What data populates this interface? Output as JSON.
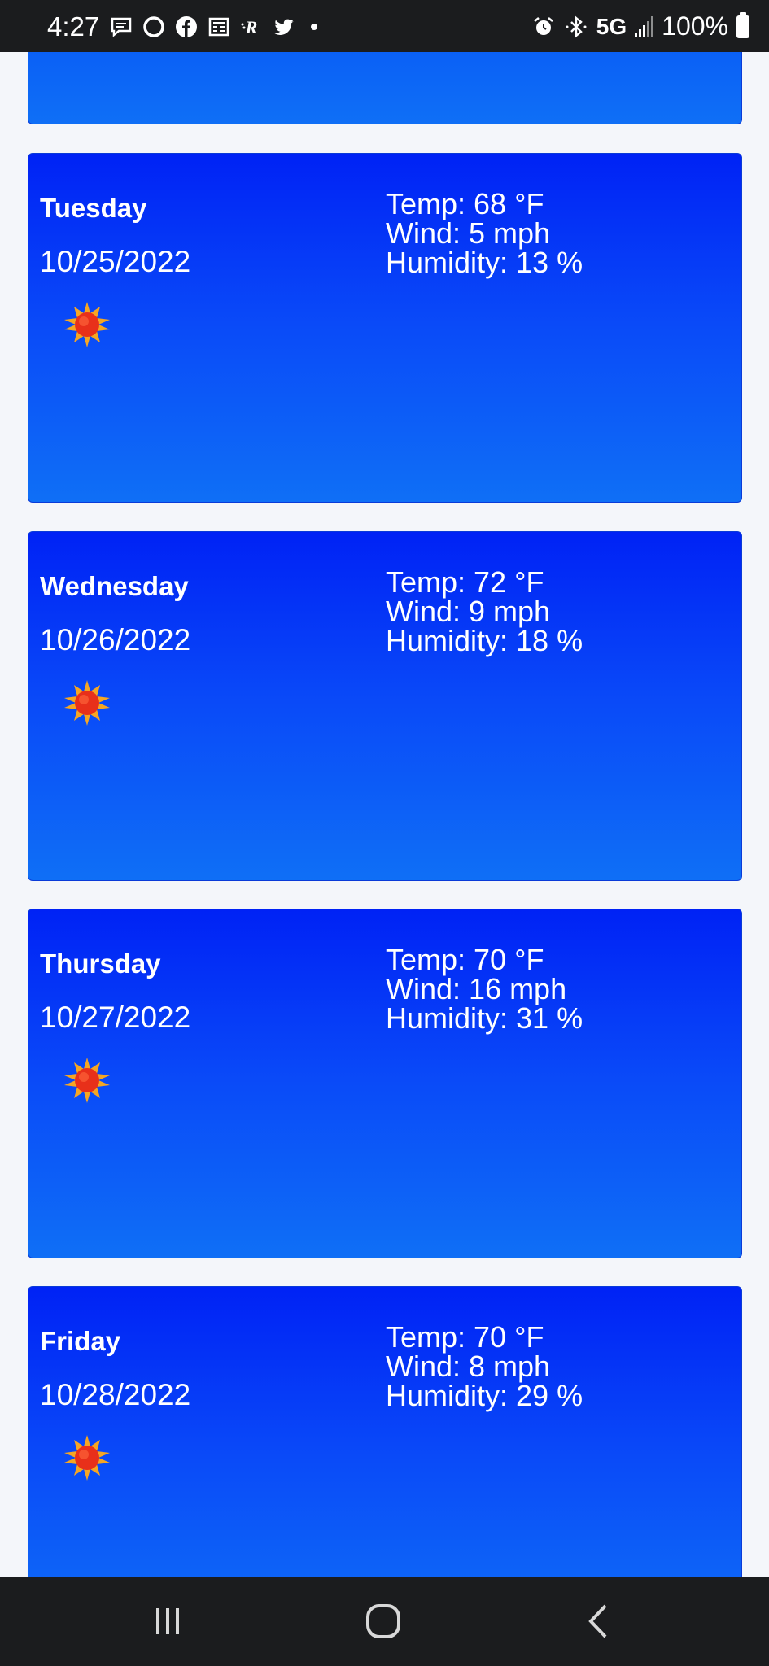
{
  "status_bar": {
    "time": "4:27",
    "network": "5G",
    "battery": "100%"
  },
  "forecast": [
    {
      "day": "Tuesday",
      "date": "10/25/2022",
      "icon": "sun-icon",
      "temp": "Temp: 68 °F",
      "wind": "Wind: 5 mph",
      "humidity": "Humidity: 13 %"
    },
    {
      "day": "Wednesday",
      "date": "10/26/2022",
      "icon": "sun-icon",
      "temp": "Temp: 72 °F",
      "wind": "Wind: 9 mph",
      "humidity": "Humidity: 18 %"
    },
    {
      "day": "Thursday",
      "date": "10/27/2022",
      "icon": "sun-icon",
      "temp": "Temp: 70 °F",
      "wind": "Wind: 16 mph",
      "humidity": "Humidity: 31 %"
    },
    {
      "day": "Friday",
      "date": "10/28/2022",
      "icon": "sun-icon",
      "temp": "Temp: 70 °F",
      "wind": "Wind: 8 mph",
      "humidity": "Humidity: 29 %"
    }
  ],
  "colors": {
    "card_top": "#0022f5",
    "card_bottom": "#0f6ff6",
    "page_bg": "#f4f6fa",
    "system_bar": "#1b1c1e"
  }
}
